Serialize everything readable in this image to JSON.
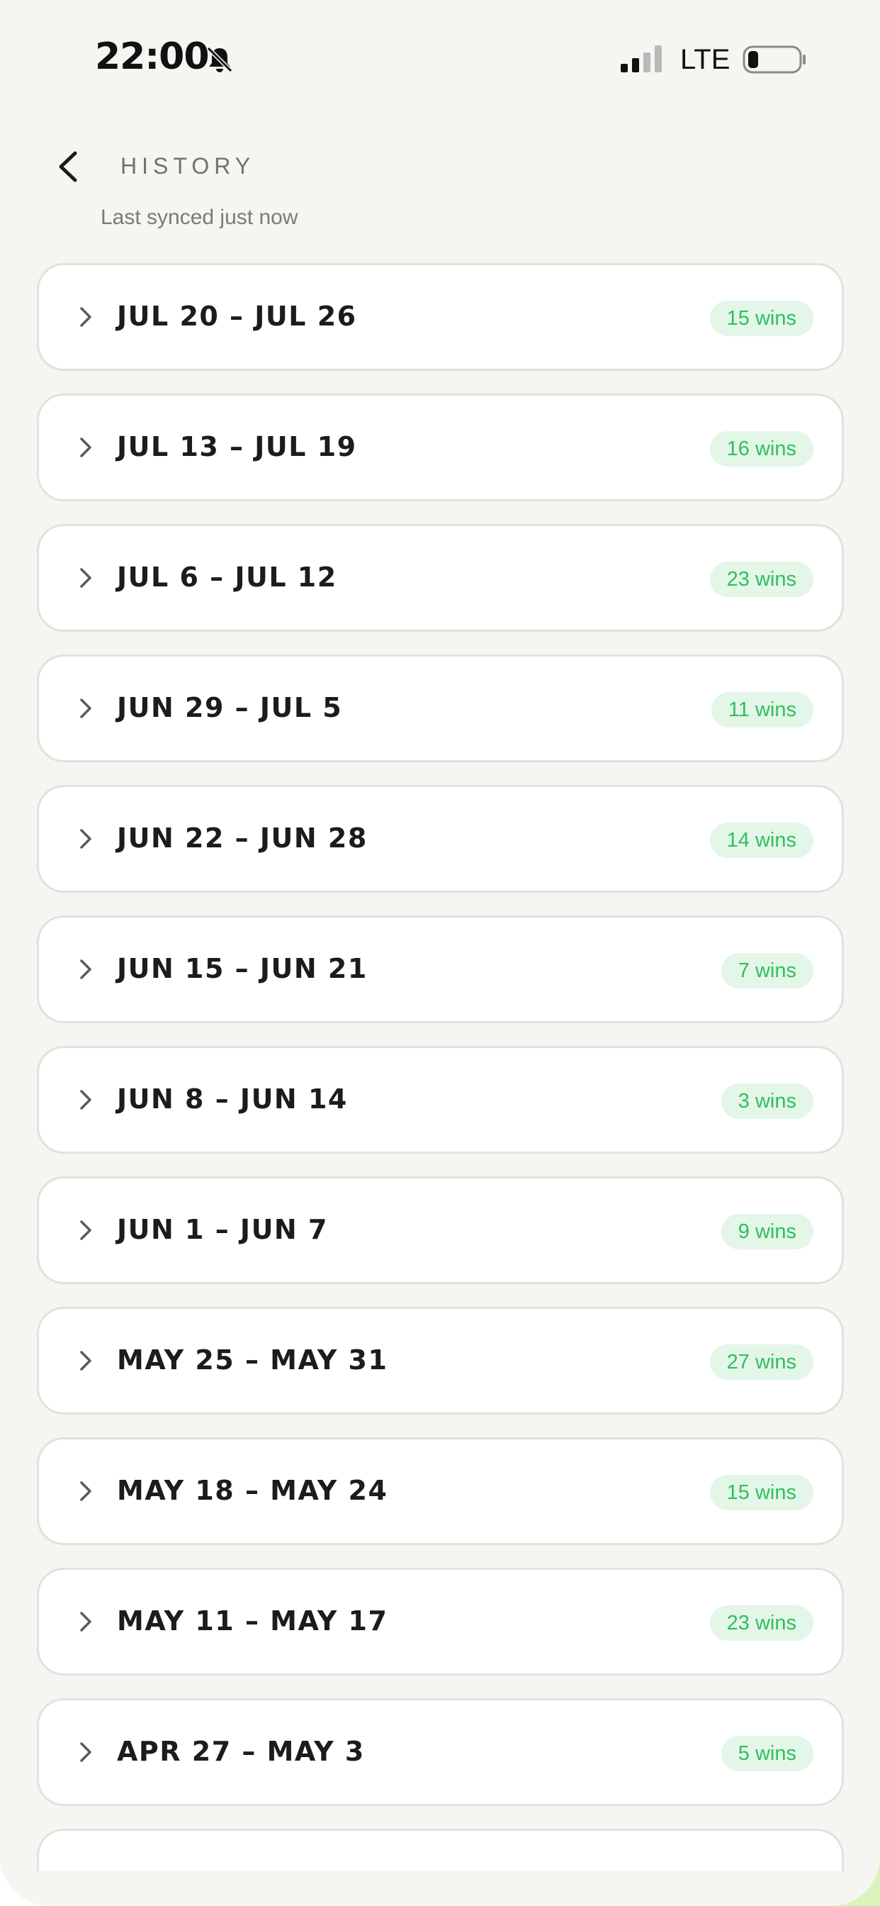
{
  "status_bar": {
    "time": "22:00",
    "network": "LTE",
    "icons": [
      "bell-slash-icon",
      "signal-icon",
      "battery-icon"
    ]
  },
  "header": {
    "title": "HISTORY",
    "sync_status": "Last synced just now",
    "back_icon": "chevron-left-icon"
  },
  "weeks": [
    {
      "range": "JUL 20 – JUL 26",
      "wins": "15 wins"
    },
    {
      "range": "JUL 13 – JUL 19",
      "wins": "16 wins"
    },
    {
      "range": "JUL 6 – JUL 12",
      "wins": "23 wins"
    },
    {
      "range": "JUN 29 – JUL 5",
      "wins": "11 wins"
    },
    {
      "range": "JUN 22 – JUN 28",
      "wins": "14 wins"
    },
    {
      "range": "JUN 15 – JUN 21",
      "wins": "7 wins"
    },
    {
      "range": "JUN 8 – JUN 14",
      "wins": "3 wins"
    },
    {
      "range": "JUN 1 – JUN 7",
      "wins": "9 wins"
    },
    {
      "range": "MAY 25 – MAY 31",
      "wins": "27 wins"
    },
    {
      "range": "MAY 18 – MAY 24",
      "wins": "15 wins"
    },
    {
      "range": "MAY 11 – MAY 17",
      "wins": "23 wins"
    },
    {
      "range": "APR 27 – MAY 3",
      "wins": "5 wins"
    }
  ],
  "colors": {
    "background": "#f6f5f1",
    "card": "#ffffff",
    "card_border": "#e3e1dc",
    "badge_bg": "#e3f6e7",
    "badge_text": "#2fbf60",
    "title_text": "#707070"
  }
}
